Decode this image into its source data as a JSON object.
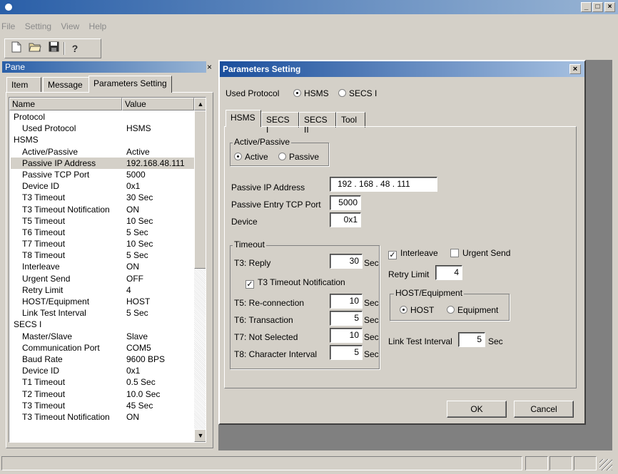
{
  "menu": [
    "File",
    "Setting",
    "View",
    "Help"
  ],
  "toolbar": {
    "icons": [
      "new-file-icon",
      "open-folder-icon",
      "save-disk-icon",
      "help-icon"
    ]
  },
  "pane": {
    "title": "Pane",
    "close_glyph": "×",
    "tabs": [
      "Item",
      "Message",
      "Parameters Setting"
    ],
    "columns": [
      "Name",
      "Value"
    ],
    "rows": [
      {
        "name": "Protocol",
        "value": "",
        "indent": false
      },
      {
        "name": "Used Protocol",
        "value": "HSMS",
        "indent": true
      },
      {
        "name": "HSMS",
        "value": "",
        "indent": false
      },
      {
        "name": "Active/Passive",
        "value": "Active",
        "indent": true
      },
      {
        "name": "Passive IP Address",
        "value": "192.168.48.111",
        "indent": true,
        "selected": true
      },
      {
        "name": "Passive TCP Port",
        "value": "5000",
        "indent": true
      },
      {
        "name": "Device ID",
        "value": "0x1",
        "indent": true
      },
      {
        "name": "T3 Timeout",
        "value": "30 Sec",
        "indent": true
      },
      {
        "name": "T3 Timeout Notification",
        "value": "ON",
        "indent": true
      },
      {
        "name": "T5 Timeout",
        "value": "10 Sec",
        "indent": true
      },
      {
        "name": "T6 Timeout",
        "value": "5 Sec",
        "indent": true
      },
      {
        "name": "T7 Timeout",
        "value": "10 Sec",
        "indent": true
      },
      {
        "name": "T8 Timeout",
        "value": "5 Sec",
        "indent": true
      },
      {
        "name": "Interleave",
        "value": "ON",
        "indent": true
      },
      {
        "name": "Urgent Send",
        "value": "OFF",
        "indent": true
      },
      {
        "name": "Retry Limit",
        "value": "4",
        "indent": true
      },
      {
        "name": "HOST/Equipment",
        "value": "HOST",
        "indent": true
      },
      {
        "name": "Link Test Interval",
        "value": "5 Sec",
        "indent": true
      },
      {
        "name": "SECS I",
        "value": "",
        "indent": false
      },
      {
        "name": "Master/Slave",
        "value": "Slave",
        "indent": true
      },
      {
        "name": "Communication Port",
        "value": "COM5",
        "indent": true
      },
      {
        "name": "Baud Rate",
        "value": "9600 BPS",
        "indent": true
      },
      {
        "name": "Device ID",
        "value": "0x1",
        "indent": true
      },
      {
        "name": "T1 Timeout",
        "value": "0.5 Sec",
        "indent": true
      },
      {
        "name": "T2 Timeout",
        "value": "10.0 Sec",
        "indent": true
      },
      {
        "name": "T3 Timeout",
        "value": "45 Sec",
        "indent": true
      },
      {
        "name": "T3 Timeout Notification",
        "value": "ON",
        "indent": true
      }
    ]
  },
  "dialog": {
    "title": "Parameters Setting",
    "close_glyph": "×",
    "used_protocol_label": "Used Protocol",
    "protocol_options": [
      "HSMS",
      "SECS I"
    ],
    "protocol_selected": "HSMS",
    "tabs": [
      "HSMS",
      "SECS I",
      "SECS II",
      "Tool"
    ],
    "active_passive": {
      "title": "Active/Passive",
      "options": [
        "Active",
        "Passive"
      ],
      "selected": "Active"
    },
    "passive_ip": {
      "label": "Passive IP Address",
      "value": "192 . 168 . 48 . 111"
    },
    "passive_port": {
      "label": "Passive Entry TCP Port",
      "value": "5000"
    },
    "device": {
      "label": "Device",
      "value": "0x1"
    },
    "timeout": {
      "title": "Timeout",
      "unit": "Sec",
      "t3": {
        "label": "T3: Reply",
        "value": "30"
      },
      "t3_notification": {
        "label": "T3 Timeout Notification",
        "checked": true
      },
      "t5": {
        "label": "T5: Re-connection",
        "value": "10"
      },
      "t6": {
        "label": "T6: Transaction",
        "value": "5"
      },
      "t7": {
        "label": "T7: Not Selected",
        "value": "10"
      },
      "t8": {
        "label": "T8: Character Interval",
        "value": "5"
      }
    },
    "interleave": {
      "label": "Interleave",
      "checked": true
    },
    "urgent_send": {
      "label": "Urgent Send",
      "checked": false
    },
    "retry_limit": {
      "label": "Retry Limit",
      "value": "4"
    },
    "host_equipment": {
      "title": "HOST/Equipment",
      "options": [
        "HOST",
        "Equipment"
      ],
      "selected": "HOST"
    },
    "link_test": {
      "label": "Link Test Interval",
      "value": "5",
      "unit": "Sec"
    },
    "ok_label": "OK",
    "cancel_label": "Cancel"
  }
}
